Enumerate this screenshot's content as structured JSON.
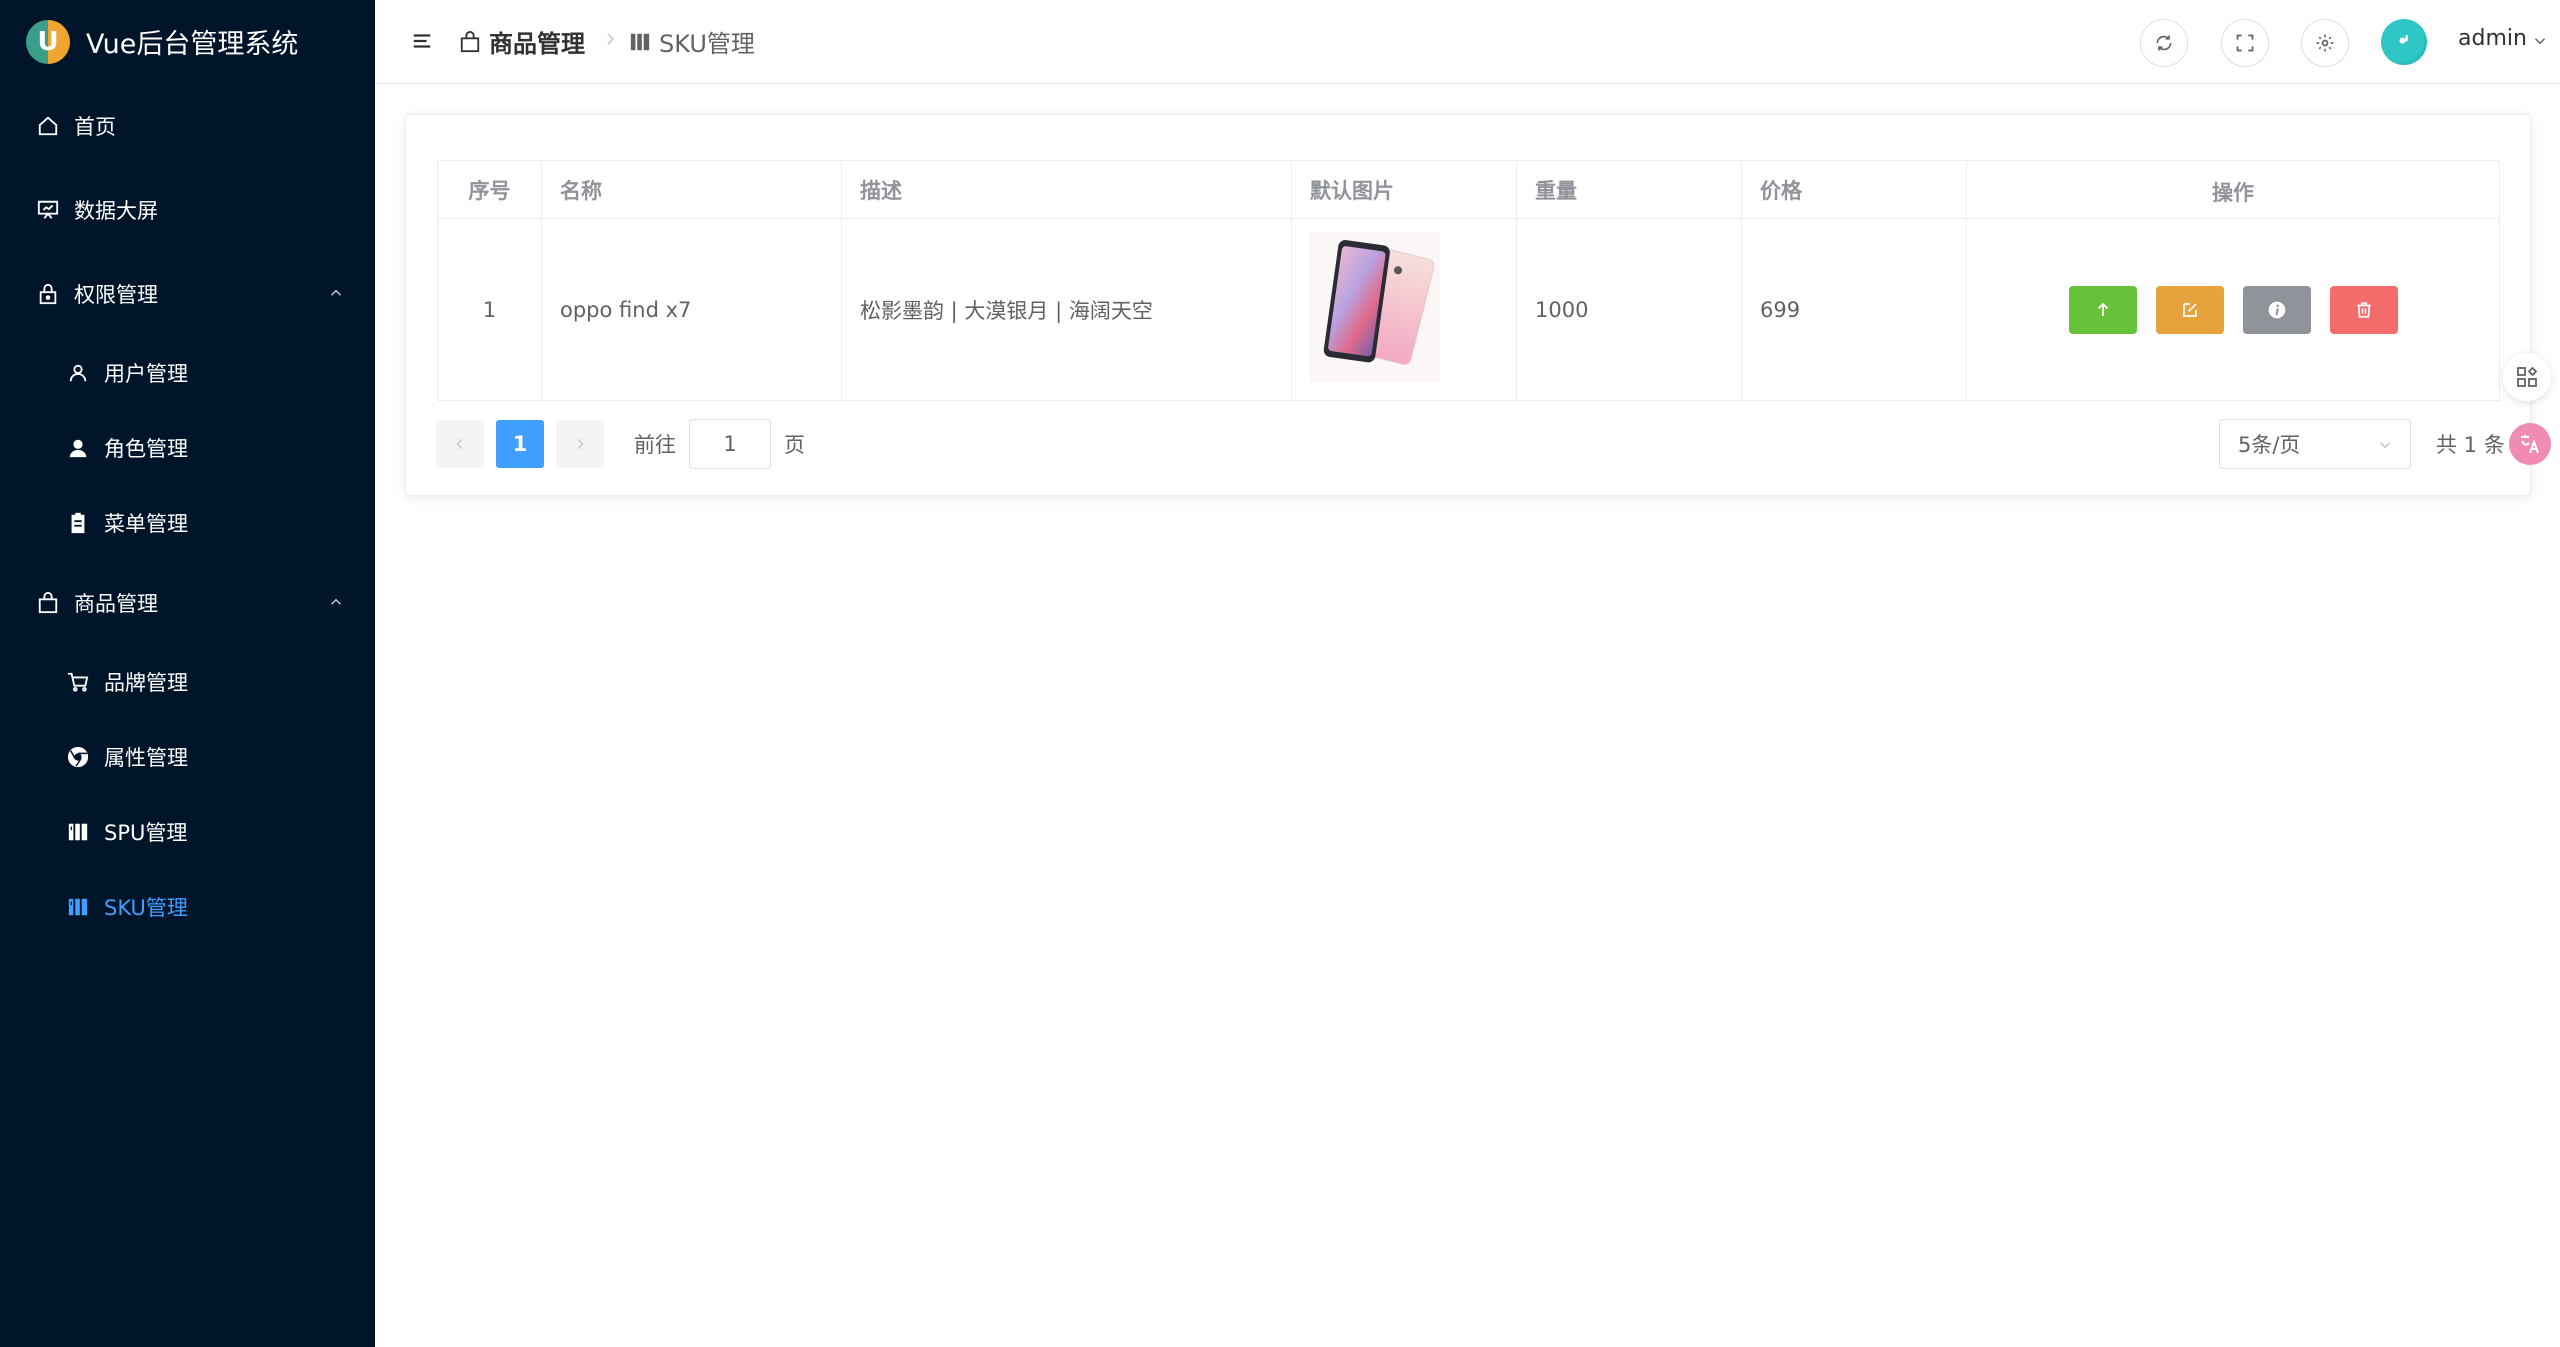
{
  "app": {
    "title": "Vue后台管理系统",
    "logo_letter": "U"
  },
  "sidebar": {
    "items": [
      {
        "label": "首页",
        "icon": "home-icon"
      },
      {
        "label": "数据大屏",
        "icon": "screen-icon"
      },
      {
        "label": "权限管理",
        "icon": "lock-icon",
        "expanded": true
      },
      {
        "label": "用户管理",
        "icon": "user-icon"
      },
      {
        "label": "角色管理",
        "icon": "user-filled-icon"
      },
      {
        "label": "菜单管理",
        "icon": "clipboard-icon"
      },
      {
        "label": "商品管理",
        "icon": "shopping-bag-icon",
        "expanded": true
      },
      {
        "label": "品牌管理",
        "icon": "shopping-cart-icon"
      },
      {
        "label": "属性管理",
        "icon": "chrome-icon"
      },
      {
        "label": "SPU管理",
        "icon": "calendar-icon"
      },
      {
        "label": "SKU管理",
        "icon": "calendar-icon",
        "active": true
      }
    ]
  },
  "header": {
    "breadcrumb": [
      {
        "label": "商品管理",
        "icon": "shopping-bag-icon"
      },
      {
        "label": "SKU管理",
        "icon": "calendar-icon"
      }
    ],
    "user": "admin"
  },
  "table": {
    "columns": [
      "序号",
      "名称",
      "描述",
      "默认图片",
      "重量",
      "价格",
      "操作"
    ],
    "rows": [
      {
        "index": "1",
        "name": "oppo find x7",
        "desc": "松影墨韵 | 大漠银月 | 海阔天空",
        "weight": "1000",
        "price": "699"
      }
    ]
  },
  "pagination": {
    "current": "1",
    "goto_label": "前往",
    "page_value": "1",
    "page_suffix": "页",
    "page_size": "5条/页",
    "total": "共 1 条"
  },
  "colors": {
    "sidebar_bg": "#001529",
    "accent": "#409eff",
    "success": "#67c23a",
    "warning": "#e6a23c",
    "info": "#909399",
    "danger": "#f56c6c"
  }
}
